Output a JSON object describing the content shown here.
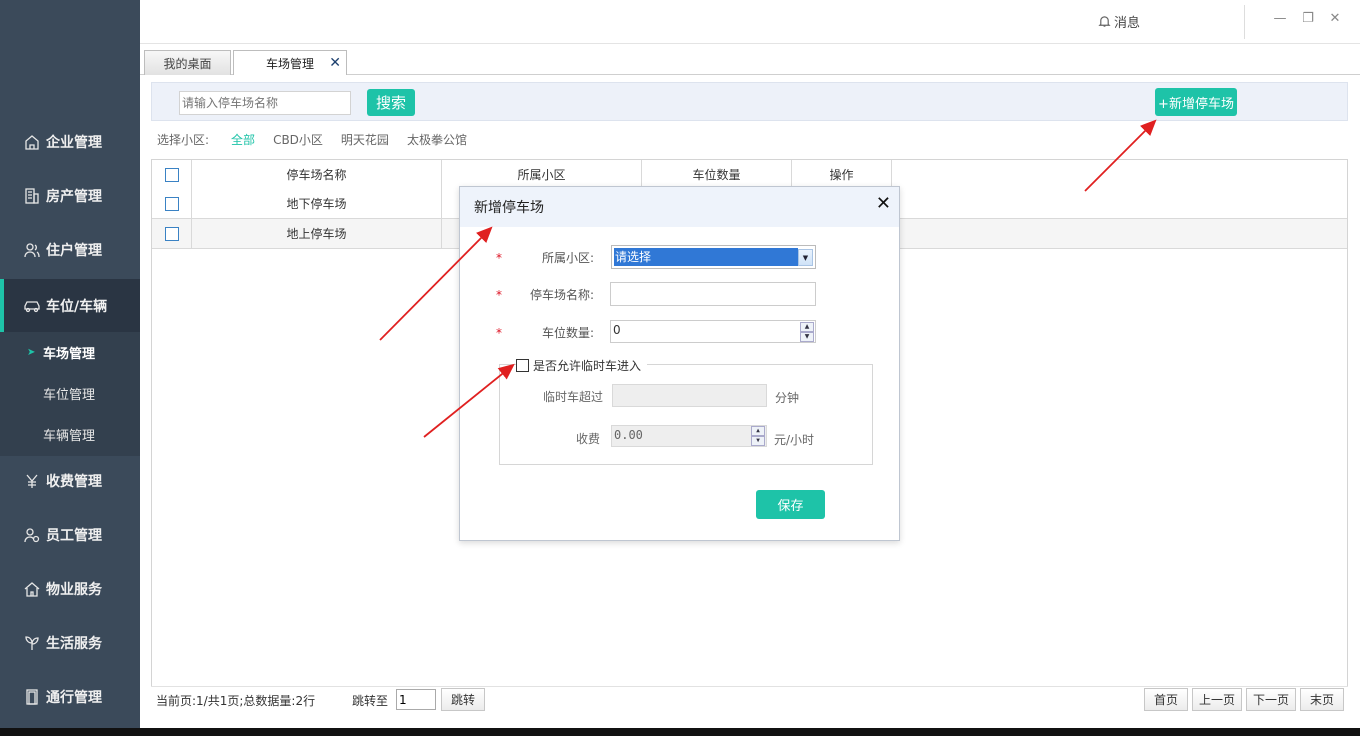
{
  "topbar": {
    "message_label": "消息"
  },
  "tabs": [
    {
      "label": "我的桌面"
    },
    {
      "label": "车场管理"
    }
  ],
  "sidebar": {
    "items": [
      {
        "label": "企业管理",
        "icon": "building-icon"
      },
      {
        "label": "房产管理",
        "icon": "office-icon"
      },
      {
        "label": "住户管理",
        "icon": "users-icon"
      },
      {
        "label": "车位/车辆",
        "icon": "car-icon"
      },
      {
        "label": "收费管理",
        "icon": "yen-icon"
      },
      {
        "label": "员工管理",
        "icon": "staff-icon"
      },
      {
        "label": "物业服务",
        "icon": "home-icon"
      },
      {
        "label": "生活服务",
        "icon": "leaf-icon"
      },
      {
        "label": "通行管理",
        "icon": "door-icon"
      }
    ],
    "subitems": [
      {
        "label": "车场管理"
      },
      {
        "label": "车位管理"
      },
      {
        "label": "车辆管理"
      }
    ]
  },
  "search": {
    "placeholder": "请输入停车场名称",
    "button_label": "搜索",
    "add_label": "+新增停车场"
  },
  "filter": {
    "label": "选择小区:",
    "options": [
      "全部",
      "CBD小区",
      "明天花园",
      "太极拳公馆"
    ],
    "selected": "全部"
  },
  "table": {
    "columns": [
      "停车场名称",
      "所属小区",
      "车位数量",
      "操作"
    ],
    "rows": [
      {
        "name": "地下停车场"
      },
      {
        "name": "地上停车场"
      }
    ]
  },
  "pager": {
    "info": "当前页:1/共1页;总数据量:2行",
    "jump_label": "跳转至",
    "jump_value": "1",
    "jump_button": "跳转",
    "first": "首页",
    "prev": "上一页",
    "next": "下一页",
    "last": "末页"
  },
  "modal": {
    "title": "新增停车场",
    "community_label": "所属小区:",
    "community_value": "请选择",
    "name_label": "停车场名称:",
    "name_value": "",
    "count_label": "车位数量:",
    "count_value": "0",
    "temp_checkbox_label": "是否允许临时车进入",
    "temp_over_label": "临时车超过",
    "temp_over_unit": "分钟",
    "fee_label": "收费",
    "fee_value": "0.00",
    "fee_unit": "元/小时",
    "save_label": "保存"
  },
  "colors": {
    "accent": "#1ec3a8",
    "sidebar_bg": "#3b4a5a",
    "arrow": "#e02020"
  }
}
